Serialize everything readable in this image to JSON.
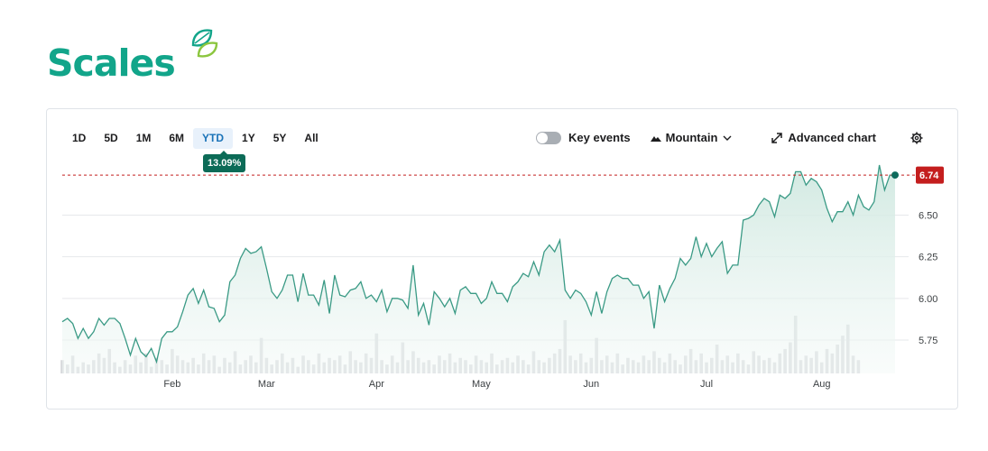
{
  "brand": {
    "name": "Scales",
    "color": "#12a58a",
    "leaf_color": "#8cc63f",
    "icon": "leaf-logo-icon"
  },
  "toolbar": {
    "ranges": [
      "1D",
      "5D",
      "1M",
      "6M",
      "YTD",
      "1Y",
      "5Y",
      "All"
    ],
    "active_range": "YTD",
    "change_badge": "13.09%",
    "key_events_label": "Key events",
    "chart_type_label": "Mountain",
    "advanced_chart_label": "Advanced chart",
    "icons": {
      "mountain": "mountain-icon",
      "dropdown": "chevron-down-icon",
      "advanced": "expand-arrows-icon",
      "settings": "gear-icon"
    }
  },
  "chart_data": {
    "type": "area",
    "y_ticks": [
      5.75,
      6.0,
      6.25,
      6.5
    ],
    "y_tick_labels": [
      "5.75",
      "6.00",
      "6.25",
      "6.50"
    ],
    "ylim": [
      5.55,
      6.8
    ],
    "x_ticks": [
      {
        "label": "Feb",
        "day": 21
      },
      {
        "label": "Mar",
        "day": 39
      },
      {
        "label": "Apr",
        "day": 60
      },
      {
        "label": "May",
        "day": 80
      },
      {
        "label": "Jun",
        "day": 101
      },
      {
        "label": "Jul",
        "day": 123
      },
      {
        "label": "Aug",
        "day": 145
      }
    ],
    "last_price": 6.74,
    "last_price_label": "6.74",
    "reference_line": 6.74,
    "line_color": "#3a9a85",
    "area_color": "#dcefe9",
    "price_tag_color": "#c41e1e",
    "volume_color": "#d6d8db",
    "grid": true,
    "series": [
      {
        "values": [
          5.86,
          5.88,
          5.85,
          5.76,
          5.82,
          5.76,
          5.8,
          5.88,
          5.84,
          5.88,
          5.88,
          5.85,
          5.76,
          5.66,
          5.76,
          5.68,
          5.65,
          5.7,
          5.62,
          5.76,
          5.8,
          5.8,
          5.83,
          5.92,
          6.02,
          6.06,
          5.97,
          6.05,
          5.95,
          5.94,
          5.86,
          5.9,
          6.1,
          6.14,
          6.24,
          6.3,
          6.27,
          6.28,
          6.31,
          6.18,
          6.04,
          6.0,
          6.05,
          6.14,
          6.14,
          5.98,
          6.15,
          6.02,
          6.02,
          5.96,
          6.11,
          5.91,
          6.14,
          6.02,
          6.01,
          6.05,
          6.06,
          6.1,
          6.0,
          6.02,
          5.98,
          6.05,
          5.92,
          6.0,
          6.0,
          5.99,
          5.94,
          6.2,
          5.9,
          5.97,
          5.84,
          6.04,
          6.0,
          5.95,
          6.0,
          5.91,
          6.05,
          6.07,
          6.03,
          6.03,
          5.97,
          6.0,
          6.1,
          6.03,
          6.03,
          5.98,
          6.07,
          6.1,
          6.15,
          6.13,
          6.22,
          6.14,
          6.28,
          6.32,
          6.28,
          6.35,
          6.05,
          6.0,
          6.05,
          6.03,
          5.98,
          5.9,
          6.04,
          5.91,
          6.04,
          6.12,
          6.14,
          6.12,
          6.12,
          6.08,
          6.08,
          6.0,
          6.04,
          5.82,
          6.08,
          5.98,
          6.06,
          6.12,
          6.24,
          6.2,
          6.24,
          6.37,
          6.25,
          6.33,
          6.25,
          6.3,
          6.34,
          6.15,
          6.2,
          6.2,
          6.47,
          6.48,
          6.5,
          6.56,
          6.6,
          6.58,
          6.49,
          6.62,
          6.6,
          6.63,
          6.76,
          6.76,
          6.68,
          6.72,
          6.7,
          6.65,
          6.54,
          6.46,
          6.52,
          6.52,
          6.58,
          6.5,
          6.62,
          6.55,
          6.53,
          6.58,
          6.8,
          6.65,
          6.74,
          6.74
        ],
        "volumes": [
          6,
          4,
          8,
          3,
          5,
          4,
          6,
          9,
          7,
          11,
          5,
          3,
          6,
          4,
          8,
          5,
          9,
          3,
          7,
          6,
          4,
          11,
          8,
          6,
          5,
          7,
          4,
          9,
          6,
          8,
          3,
          7,
          5,
          10,
          4,
          6,
          8,
          5,
          16,
          7,
          4,
          6,
          9,
          5,
          7,
          3,
          8,
          6,
          4,
          9,
          5,
          7,
          6,
          8,
          4,
          10,
          6,
          5,
          9,
          7,
          18,
          6,
          4,
          8,
          5,
          14,
          6,
          10,
          7,
          5,
          6,
          4,
          8,
          6,
          9,
          5,
          7,
          6,
          4,
          8,
          6,
          5,
          9,
          4,
          6,
          7,
          5,
          8,
          6,
          4,
          10,
          6,
          5,
          7,
          9,
          11,
          24,
          8,
          6,
          9,
          5,
          7,
          16,
          6,
          8,
          5,
          9,
          4,
          7,
          6,
          5,
          8,
          6,
          10,
          7,
          5,
          9,
          6,
          4,
          8,
          11,
          6,
          9,
          5,
          7,
          13,
          6,
          8,
          5,
          9,
          6,
          4,
          10,
          8,
          6,
          7,
          5,
          9,
          11,
          14,
          26,
          6,
          8,
          7,
          10,
          5,
          11,
          9,
          13,
          17,
          22,
          8,
          6
        ]
      }
    ]
  }
}
